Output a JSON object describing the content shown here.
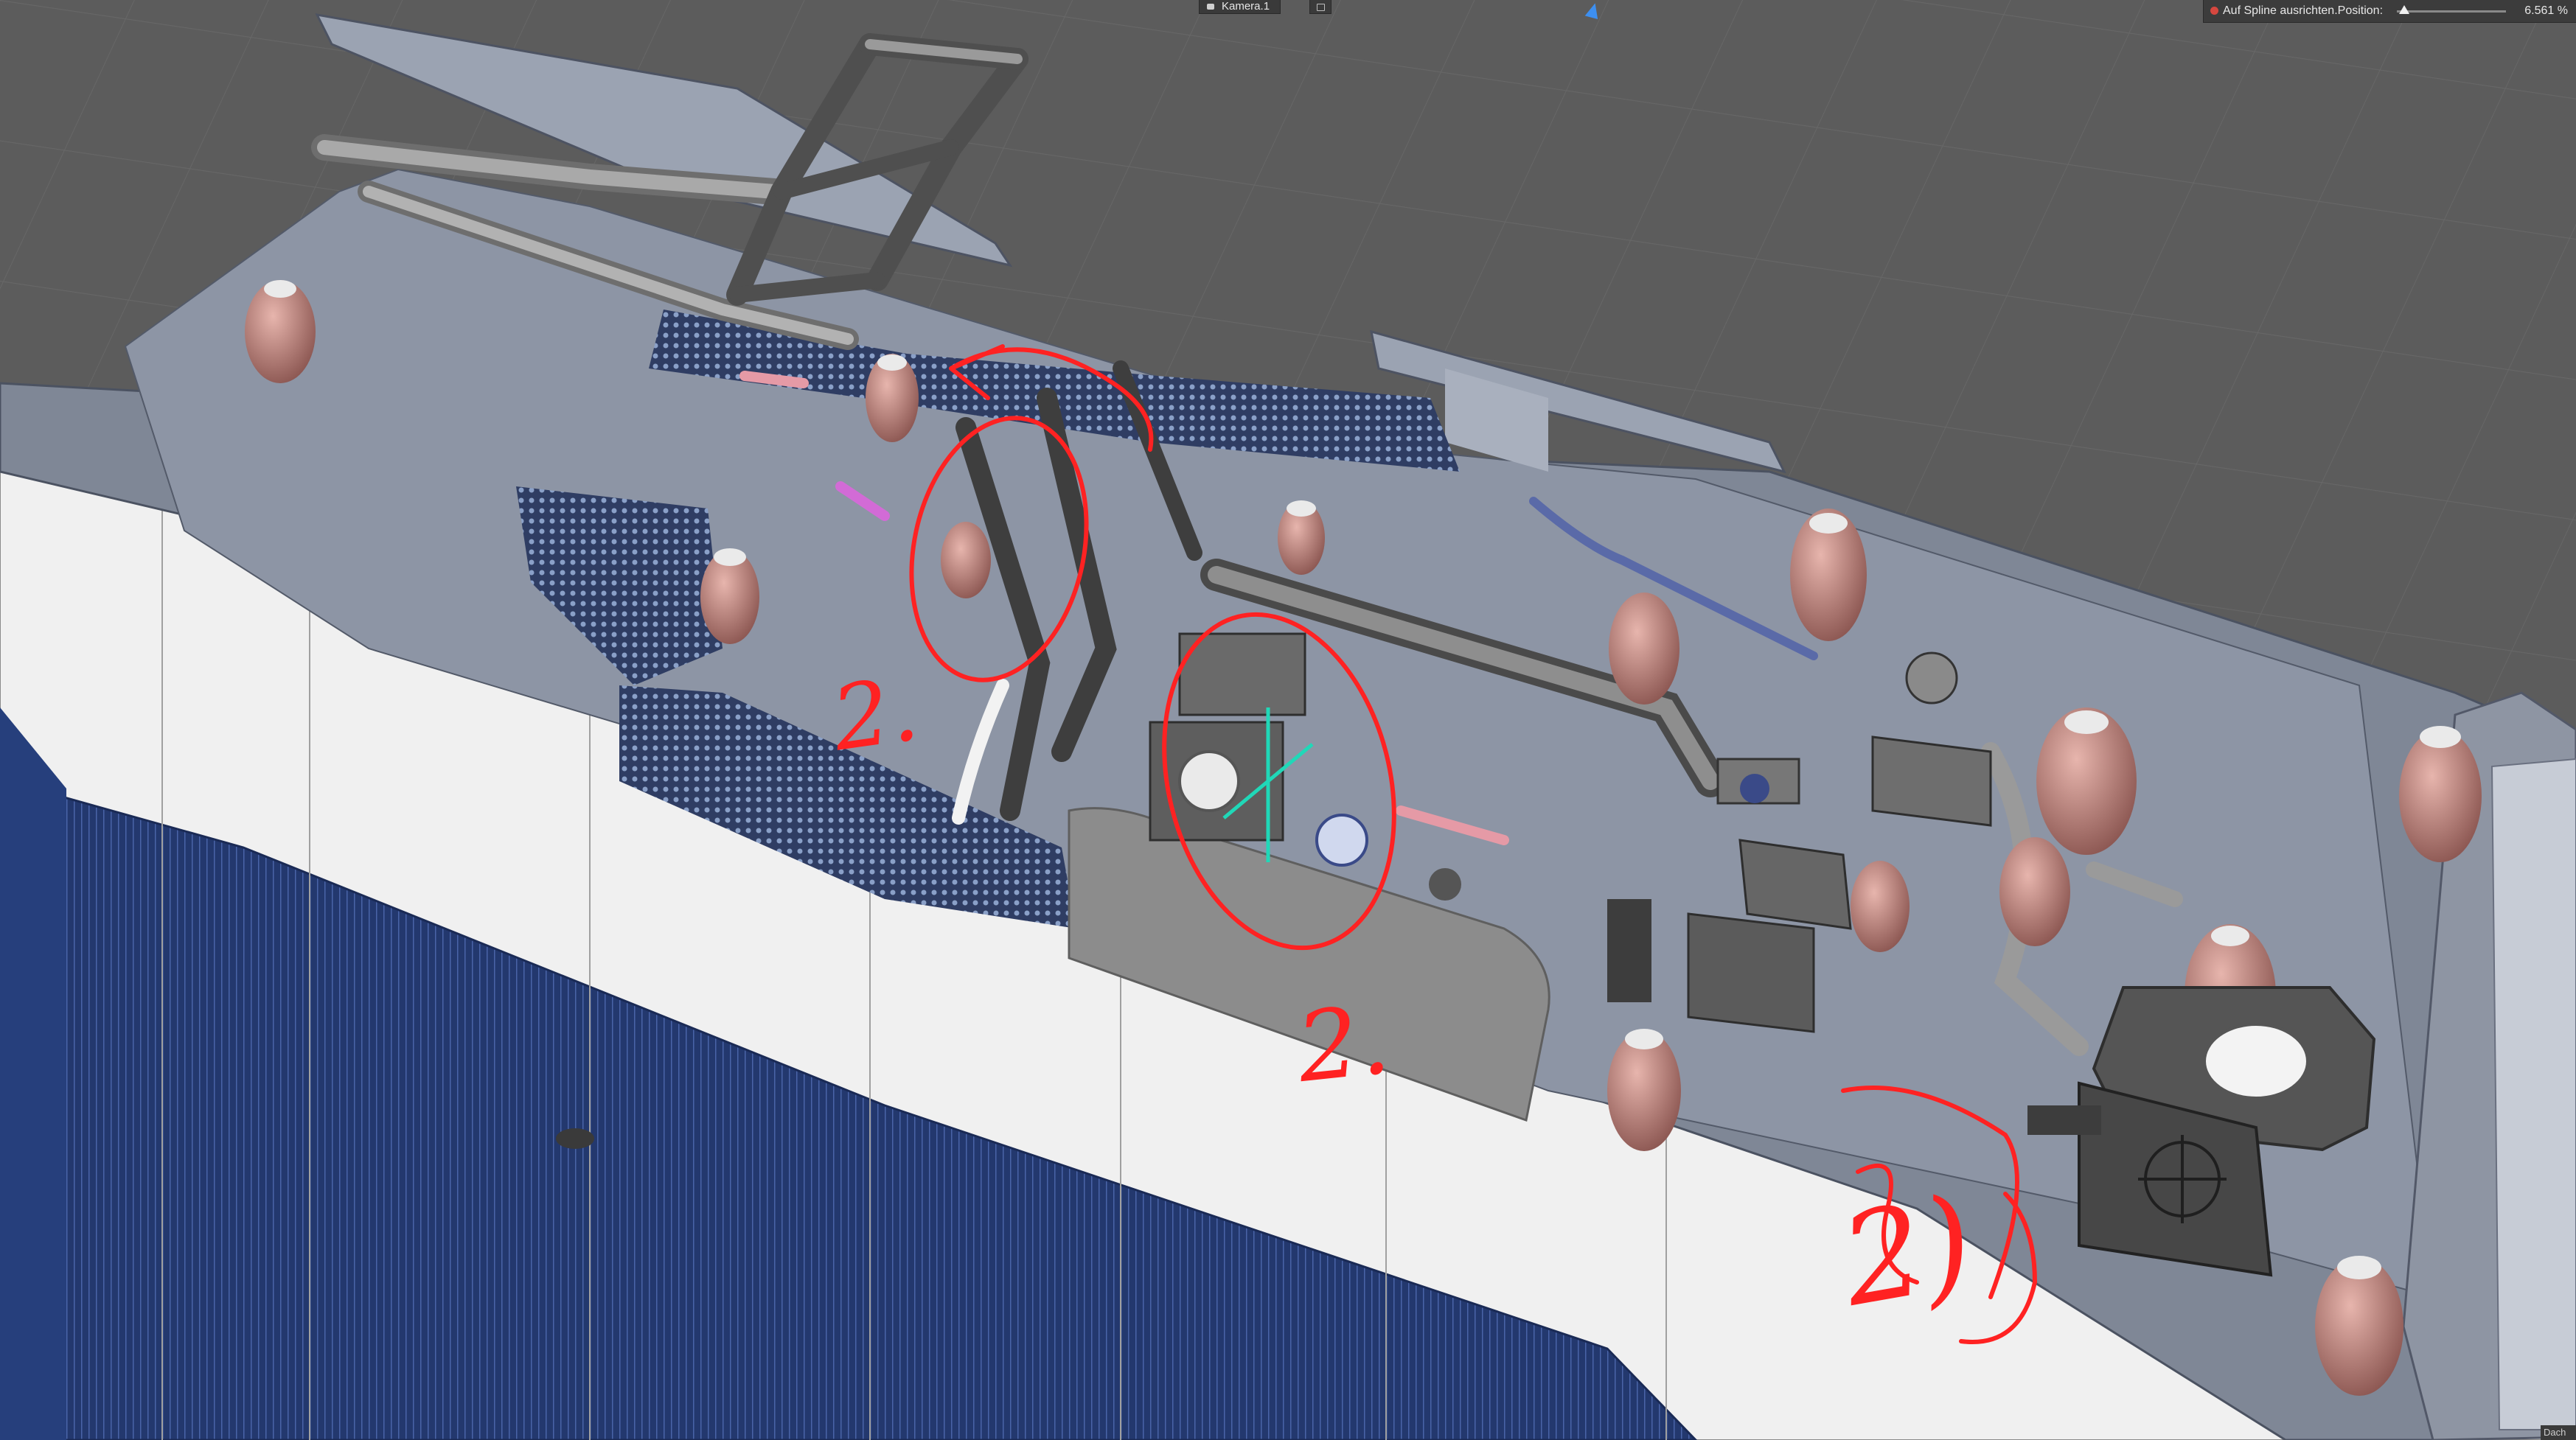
{
  "viewport": {
    "camera_label": "Kamera.1",
    "background": "#5c5c5c"
  },
  "spline_attribute": {
    "label": "Auf Spline ausrichten.Position:",
    "value": "6.561 %",
    "position_fraction": 0.06561,
    "indicator_color": "#d6473f"
  },
  "corner_tab": {
    "label": "Dach"
  },
  "annotations": {
    "color": "#ff2222",
    "label_left": "2.",
    "label_center": "2.",
    "label_right": "2)",
    "axis_color": "#20d8b8"
  },
  "model_colors": {
    "body_white": "#e6e6e6",
    "stripe_blue": "#26407e",
    "roof": "#9aa3b3",
    "insulator": "#c98a82",
    "grating": "#3a4a6e"
  }
}
